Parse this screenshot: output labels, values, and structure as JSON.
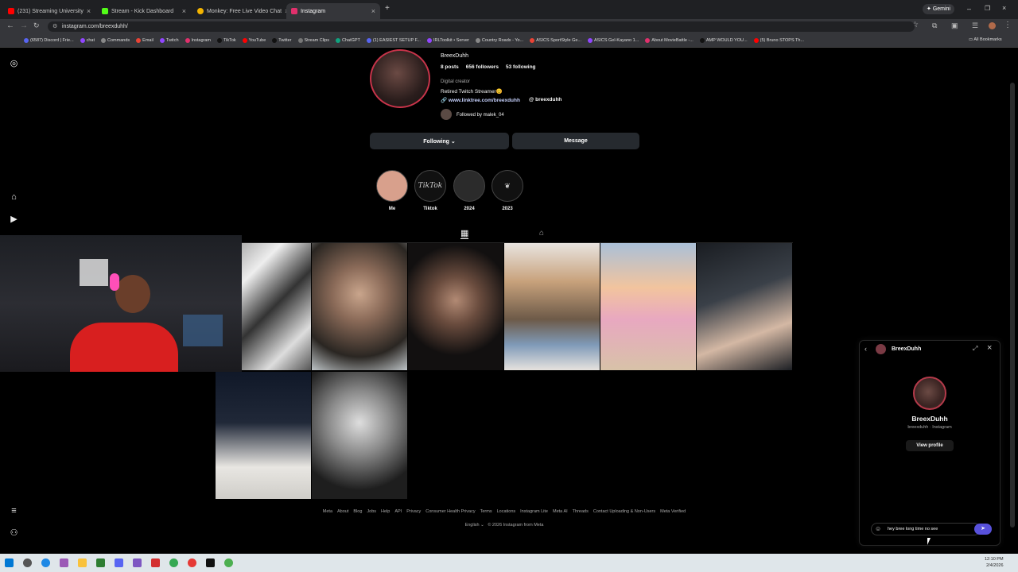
{
  "browser": {
    "tabs": [
      {
        "title": "(231) Streaming University",
        "color": "#ff0000"
      },
      {
        "title": "Stream - Kick Dashboard",
        "color": "#53fc18"
      },
      {
        "title": "Monkey: Free Live Video Chat",
        "color": "#f4b400"
      },
      {
        "title": "Instagram",
        "color": "#e1306c"
      }
    ],
    "new_tab": "+",
    "gemini": "Gemini",
    "url": "instagram.com/breexduhh/",
    "bookmarks": [
      "(6587) Discord | Frie...",
      "chat",
      "Commands",
      "Email",
      "Twitch",
      "Instagram",
      "TikTok",
      "YouTube",
      "Twitter",
      "Stream Clips",
      "ChatGPT",
      "(1) EASIEST SETUP F...",
      "IRLToolkit • Server",
      "Country Roads - Yo...",
      "ASICS SportStyle Ge...",
      "ASICS Gel-Kayano 1...",
      "About MovieBattle -...",
      "AMP WOULD YOU...",
      "(5) Bruno STOPS Th..."
    ],
    "all_bookmarks": "All Bookmarks"
  },
  "profile": {
    "username": "BreexDuhh",
    "posts": "8 posts",
    "followers": "656 followers",
    "following": "53 following",
    "category": "Digital creator",
    "bio": "Retired Twitch Streamer😊",
    "link": "www.linktree.com/breexduhh",
    "threads": "breexduhh",
    "followed_by": "Followed by malek_04",
    "following_btn": "Following ⌄",
    "message_btn": "Message"
  },
  "highlights": [
    {
      "label": "Me",
      "glyph": ""
    },
    {
      "label": "Tiktok",
      "glyph": "TikTok"
    },
    {
      "label": "2024",
      "glyph": ""
    },
    {
      "label": "2023",
      "glyph": "❦"
    }
  ],
  "footer": {
    "links": [
      "Meta",
      "About",
      "Blog",
      "Jobs",
      "Help",
      "API",
      "Privacy",
      "Consumer Health Privacy",
      "Terms",
      "Locations",
      "Instagram Lite",
      "Meta AI",
      "Threads",
      "Contact Uploading & Non-Users",
      "Meta Verified"
    ],
    "language": "English ⌄",
    "copyright": "© 2026 Instagram from Meta"
  },
  "dm": {
    "header_name": "BreexDuhh",
    "name": "BreexDuhh",
    "sub": "breexduhh · Instagram",
    "view_profile": "View profile",
    "message_text": "hey bree long time no see"
  },
  "taskbar": {
    "time": "12:10 PM",
    "date": "2/4/2026"
  },
  "colors": {
    "accent": "#0095f6",
    "send": "#5851db",
    "background": "#000000"
  }
}
